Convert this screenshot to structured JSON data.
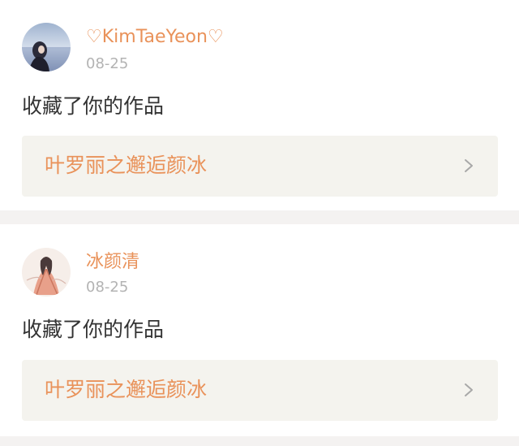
{
  "notifications": [
    {
      "username": "♡KimTaeYeon♡",
      "date": "08-25",
      "action": "收藏了你的作品",
      "work_title": "叶罗丽之邂逅颜冰",
      "avatar_icon": "user-avatar-photo"
    },
    {
      "username": "冰颜清",
      "date": "08-25",
      "action": "收藏了你的作品",
      "work_title": "叶罗丽之邂逅颜冰",
      "avatar_icon": "user-avatar-illustration"
    }
  ],
  "colors": {
    "accent": "#e9925a",
    "timestamp": "#b3b3b3",
    "text": "#333333",
    "link_background": "#f4f3ee",
    "page_background": "#f4f2f1"
  },
  "icons": {
    "chevron": "chevron-right-icon"
  }
}
